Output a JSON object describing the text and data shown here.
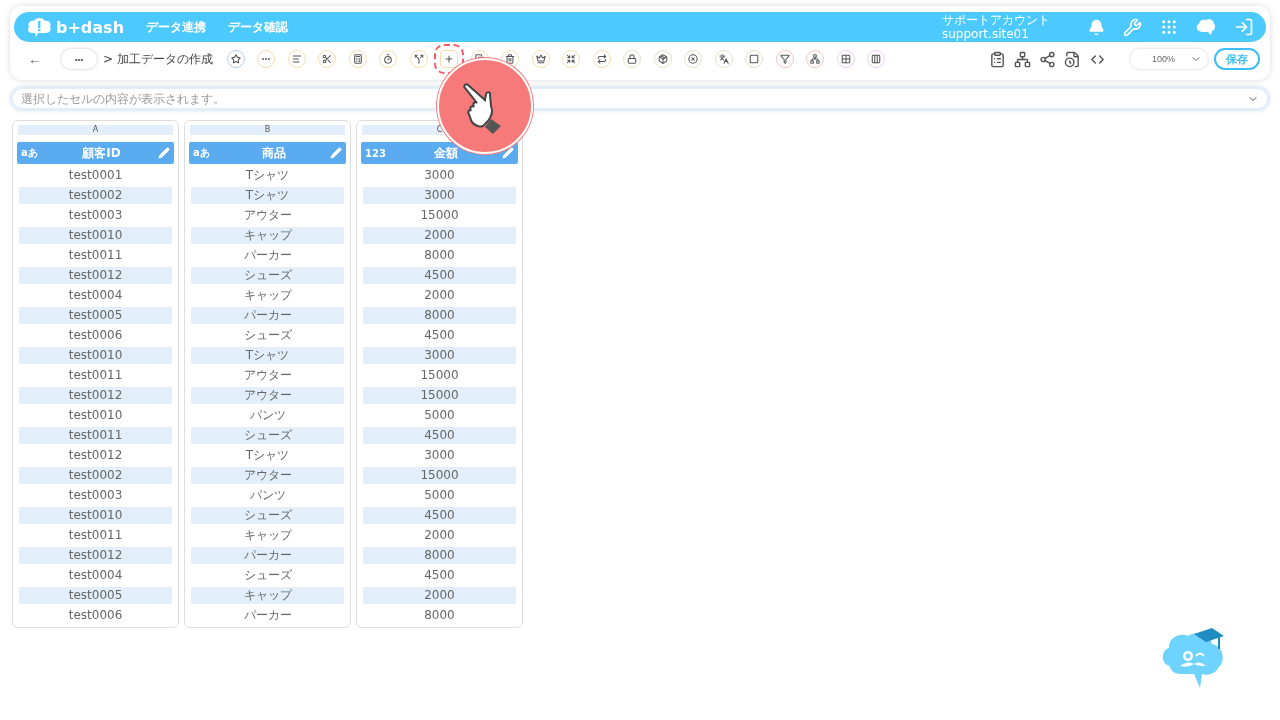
{
  "header": {
    "logo": "b+dash",
    "nav": [
      "データ連携",
      "データ確認"
    ],
    "account_name": "サポートアカウント",
    "account_id": "support.site01"
  },
  "toolbar": {
    "back": "←",
    "more": "•••",
    "breadcrumb": "> 加工データの作成",
    "tools": [
      {
        "kind": "star",
        "color": "#b9cde6",
        "highlighted": false
      },
      {
        "kind": "dots",
        "color": "#f1dfb0",
        "highlighted": false
      },
      {
        "kind": "text",
        "color": "#f1dfb0",
        "highlighted": false
      },
      {
        "kind": "scissors",
        "color": "#f1dfb0",
        "highlighted": false
      },
      {
        "kind": "calc",
        "color": "#f1dfb0",
        "highlighted": false
      },
      {
        "kind": "timer",
        "color": "#f1dfb0",
        "highlighted": false
      },
      {
        "kind": "split",
        "color": "#f1dfb0",
        "highlighted": false
      },
      {
        "kind": "plus",
        "color": "#f1dfb0",
        "highlighted": true
      },
      {
        "kind": "copy",
        "color": "#f1dfb0",
        "highlighted": false
      },
      {
        "kind": "trash",
        "color": "#f1dfb0",
        "highlighted": false
      },
      {
        "kind": "crown",
        "color": "#f1dfb0",
        "highlighted": false
      },
      {
        "kind": "shrink",
        "color": "#f1dfb0",
        "highlighted": false
      },
      {
        "kind": "repeat",
        "color": "#f1dfb0",
        "highlighted": false
      },
      {
        "kind": "lock",
        "color": "#dfe5c6",
        "highlighted": false
      },
      {
        "kind": "box",
        "color": "#dfe5c6",
        "highlighted": false
      },
      {
        "kind": "cancel",
        "color": "#dfe5c6",
        "highlighted": false
      },
      {
        "kind": "translate",
        "color": "#dfe5c6",
        "highlighted": false
      },
      {
        "kind": "square",
        "color": "#dfe5c6",
        "highlighted": false
      },
      {
        "kind": "filter",
        "color": "#f6c6c6",
        "highlighted": false
      },
      {
        "kind": "tree",
        "color": "#f6c6c6",
        "highlighted": false
      },
      {
        "kind": "grid",
        "color": "#ecd0f4",
        "highlighted": false
      },
      {
        "kind": "columns",
        "color": "#ecd0f4",
        "highlighted": false
      }
    ],
    "zoom": "100%",
    "save": "保存"
  },
  "cell_bar": {
    "placeholder": "選択したセルの内容が表示されます。"
  },
  "columns": [
    {
      "letter": "A",
      "type_label": "aあ",
      "name": "顧客ID",
      "cells": [
        "test0001",
        "test0002",
        "test0003",
        "test0010",
        "test0011",
        "test0012",
        "test0004",
        "test0005",
        "test0006",
        "test0010",
        "test0011",
        "test0012",
        "test0010",
        "test0011",
        "test0012",
        "test0002",
        "test0003",
        "test0010",
        "test0011",
        "test0012",
        "test0004",
        "test0005",
        "test0006"
      ]
    },
    {
      "letter": "B",
      "type_label": "aあ",
      "name": "商品",
      "cells": [
        "Tシャツ",
        "Tシャツ",
        "アウター",
        "キャップ",
        "パーカー",
        "シューズ",
        "キャップ",
        "パーカー",
        "シューズ",
        "Tシャツ",
        "アウター",
        "アウター",
        "パンツ",
        "シューズ",
        "Tシャツ",
        "アウター",
        "パンツ",
        "シューズ",
        "キャップ",
        "パーカー",
        "シューズ",
        "キャップ",
        "パーカー"
      ]
    },
    {
      "letter": "C",
      "type_label": "123",
      "name": "金額",
      "cells": [
        "3000",
        "3000",
        "15000",
        "2000",
        "8000",
        "4500",
        "2000",
        "8000",
        "4500",
        "3000",
        "15000",
        "15000",
        "5000",
        "4500",
        "3000",
        "15000",
        "5000",
        "4500",
        "2000",
        "8000",
        "4500",
        "2000",
        "8000"
      ]
    }
  ]
}
